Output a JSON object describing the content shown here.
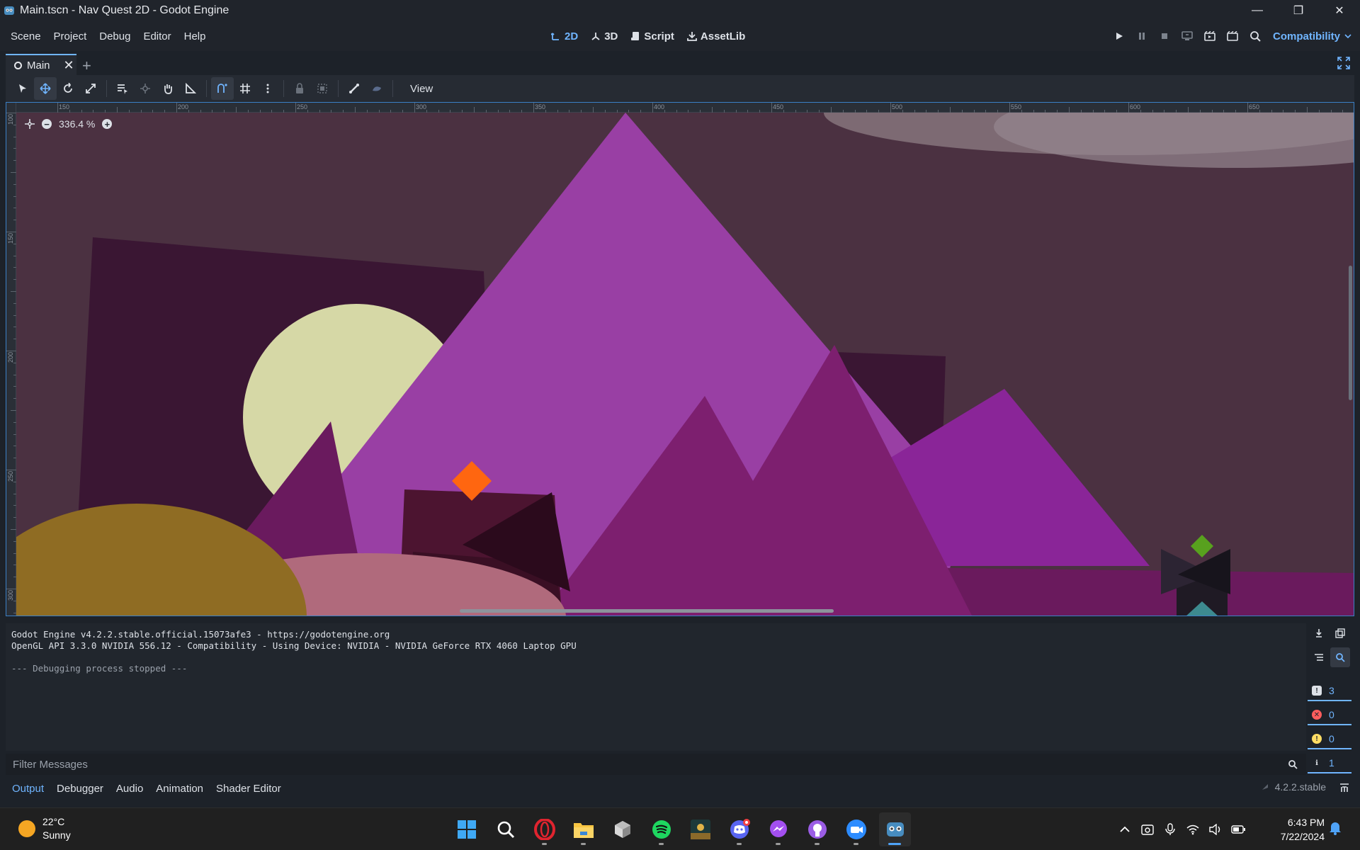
{
  "window": {
    "title": "Main.tscn - Nav Quest 2D - Godot Engine"
  },
  "menu": [
    "Scene",
    "Project",
    "Debug",
    "Editor",
    "Help"
  ],
  "workspaces": [
    {
      "label": "2D",
      "icon": "2d-icon",
      "active": true
    },
    {
      "label": "3D",
      "icon": "3d-icon",
      "active": false
    },
    {
      "label": "Script",
      "icon": "script-icon",
      "active": false
    },
    {
      "label": "AssetLib",
      "icon": "assetlib-icon",
      "active": false
    }
  ],
  "renderer": "Compatibility",
  "scene_tab": {
    "label": "Main"
  },
  "toolbar": {
    "view_label": "View"
  },
  "viewport": {
    "zoom": "336.4 %",
    "ruler_h": [
      "150",
      "200",
      "250",
      "300",
      "350",
      "400",
      "450",
      "500",
      "550",
      "600",
      "650"
    ],
    "ruler_v": [
      "100",
      "150",
      "200",
      "250",
      "300"
    ]
  },
  "output": {
    "lines": [
      "Godot Engine v4.2.2.stable.official.15073afe3 - https://godotengine.org",
      "OpenGL API 3.3.0 NVIDIA 556.12 - Compatibility - Using Device: NVIDIA - NVIDIA GeForce RTX 4060 Laptop GPU",
      "",
      "--- Debugging process stopped ---"
    ],
    "counts": {
      "messages": "3",
      "errors": "0",
      "warnings": "0",
      "editor": "1"
    },
    "filter_placeholder": "Filter Messages"
  },
  "bottom_tabs": [
    "Output",
    "Debugger",
    "Audio",
    "Animation",
    "Shader Editor"
  ],
  "version": "4.2.2.stable",
  "taskbar": {
    "weather_temp": "22°C",
    "weather_desc": "Sunny",
    "time": "6:43 PM",
    "date": "7/22/2024"
  },
  "colors": {
    "accent": "#70b5ff",
    "bg": "#1d2229",
    "panel": "#262b33"
  }
}
